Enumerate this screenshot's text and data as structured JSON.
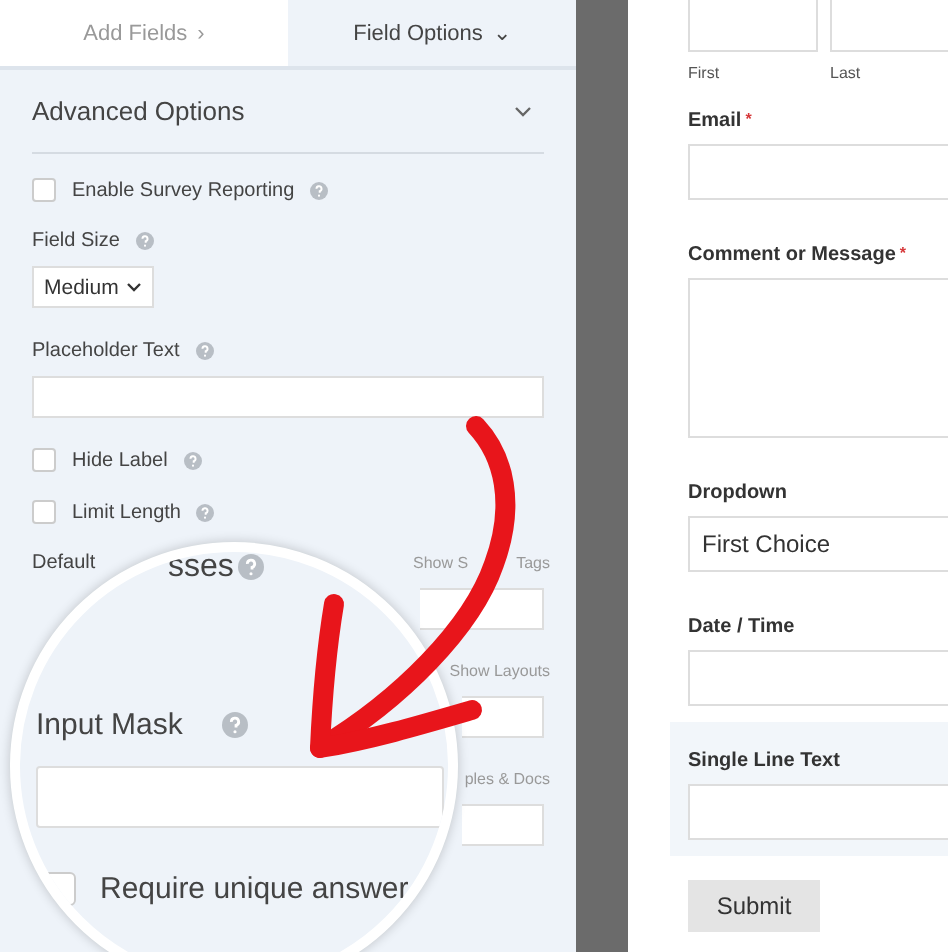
{
  "tabs": [
    {
      "label": "Add Fields",
      "icon": "›",
      "selected": false
    },
    {
      "label": "Field Options",
      "icon": "⌄",
      "selected": true
    }
  ],
  "section": {
    "title": "Advanced Options",
    "expanded": true
  },
  "options": [
    {
      "kind": "checkbox",
      "label": "Enable Survey Reporting",
      "help": true,
      "checked": false
    },
    {
      "kind": "select",
      "label": "Field Size",
      "help": true,
      "value": "Medium"
    },
    {
      "kind": "input",
      "label": "Placeholder Text",
      "help": true
    },
    {
      "kind": "checkbox",
      "label": "Hide Label",
      "help": true,
      "checked": false
    },
    {
      "kind": "checkbox",
      "label": "Limit Length",
      "help": true,
      "checked": false
    },
    {
      "kind": "input",
      "label": "Default",
      "link_start": "Show S",
      "link_end": "Tags",
      "partial": true
    },
    {
      "kind": "input",
      "link_end": "Show Layouts",
      "partial": true
    },
    {
      "kind": "input",
      "link_end": "ples & Docs",
      "partial": true
    }
  ],
  "magnifier": {
    "partial_label": "sses",
    "label": "Input Mask",
    "checkbox_label": "Require unique answer",
    "checked": false
  },
  "form": {
    "name_parts": [
      "First",
      "Last"
    ],
    "fields": [
      {
        "kind": "input",
        "label": "Email",
        "required_mark": "*",
        "highlighted": false
      },
      {
        "kind": "textarea",
        "label": "Comment or Message",
        "required_mark": "*",
        "highlighted": false
      },
      {
        "kind": "select",
        "label": "Dropdown",
        "value": "First Choice",
        "highlighted": false
      },
      {
        "kind": "input",
        "label": "Date / Time",
        "highlighted": false
      },
      {
        "kind": "input",
        "label": "Single Line Text",
        "highlighted": true
      }
    ],
    "submit": "Submit"
  }
}
